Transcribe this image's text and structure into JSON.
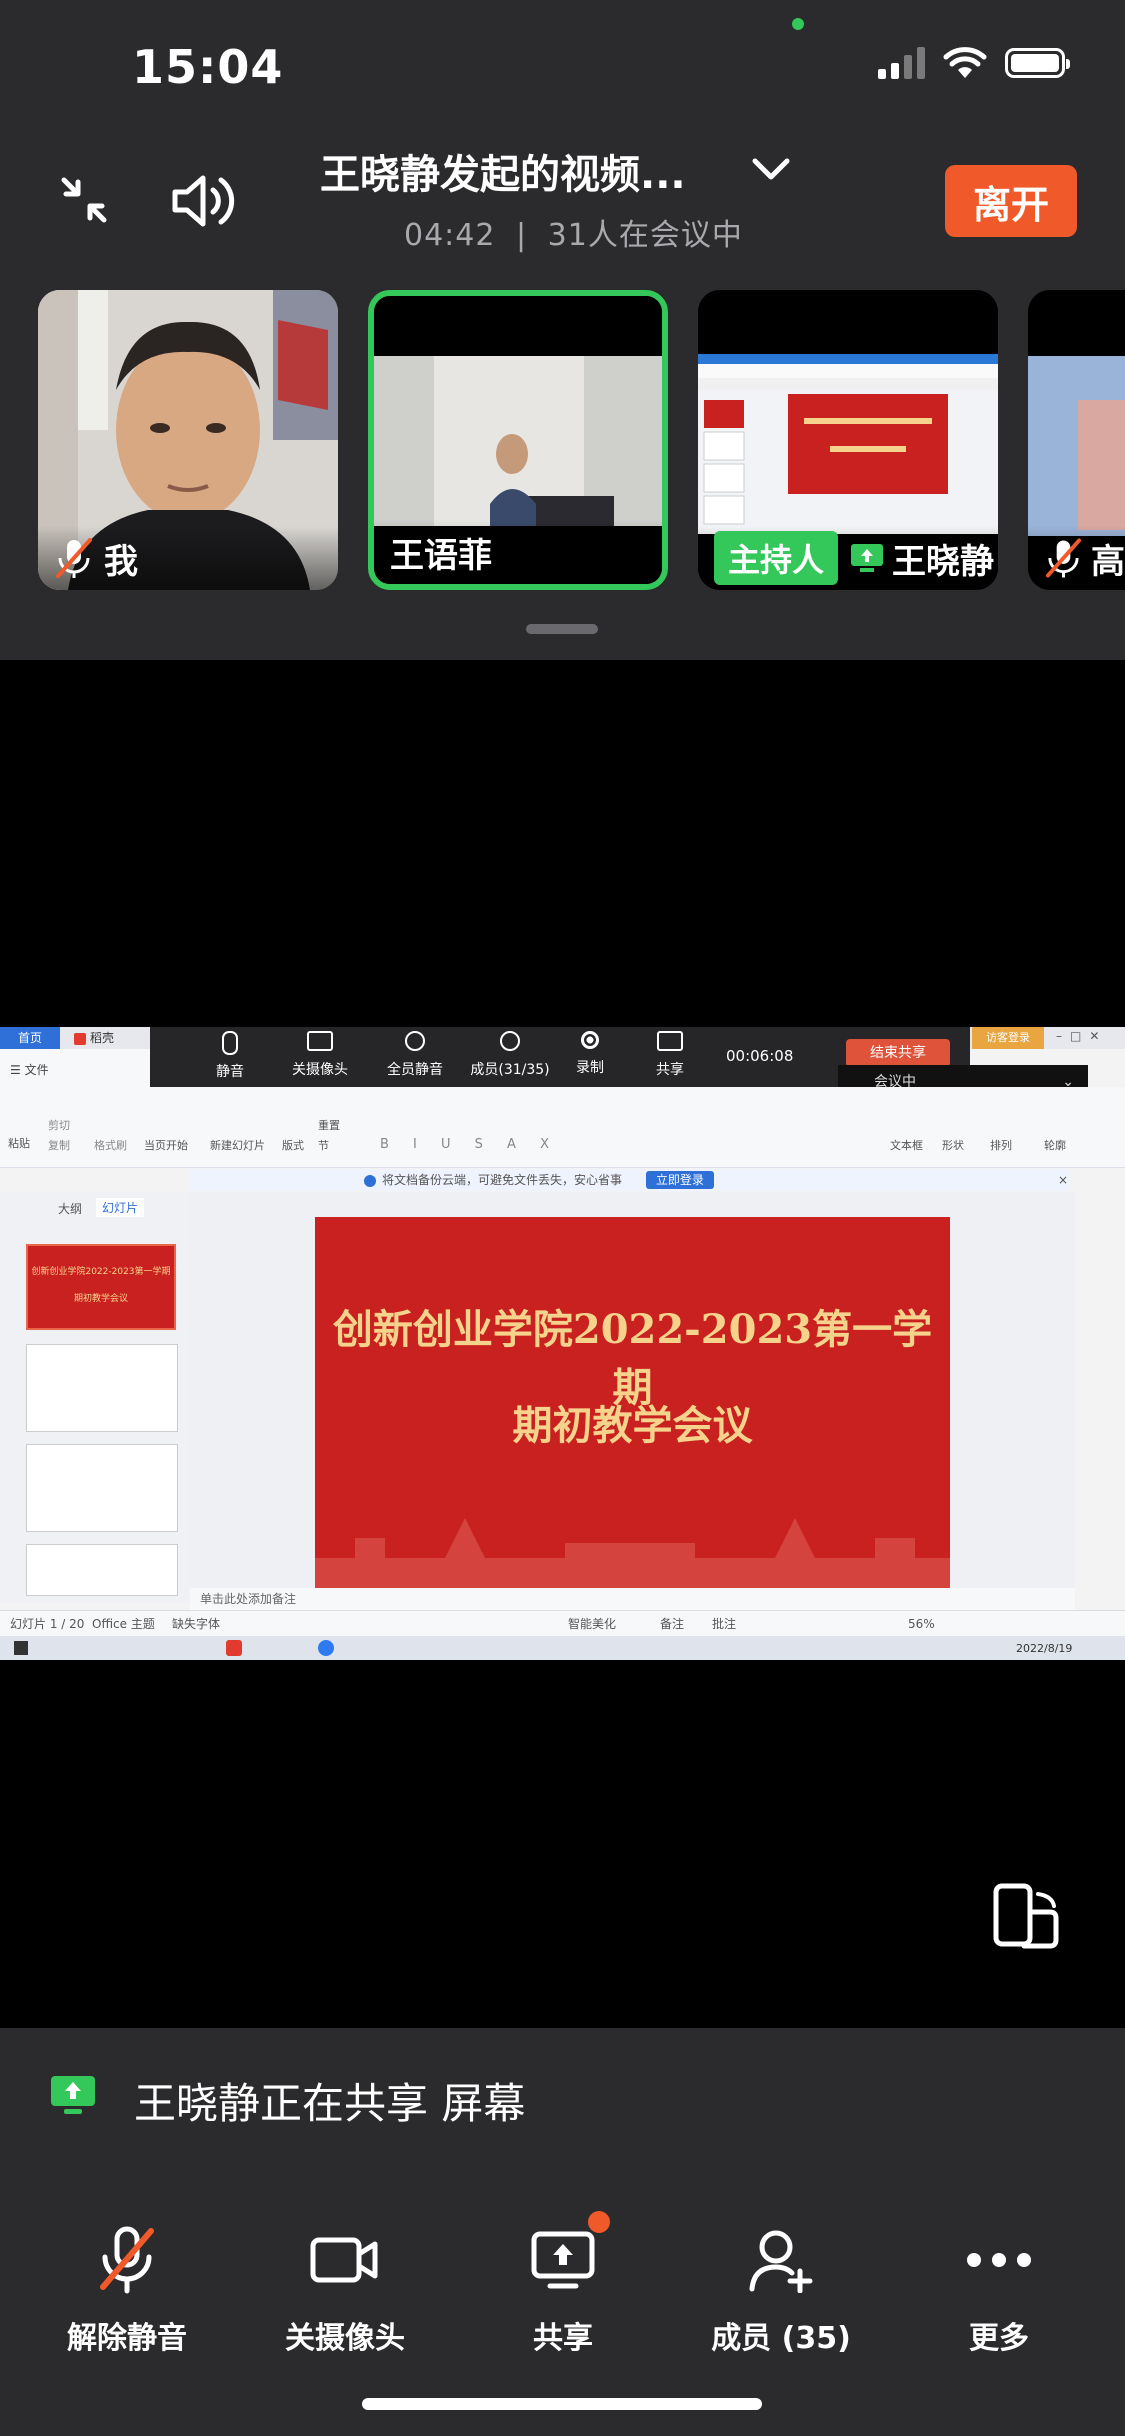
{
  "status_bar": {
    "time": "15:04"
  },
  "header": {
    "title": "王晓静发起的视频...",
    "duration": "04:42",
    "separator": "|",
    "participants_in_meeting": "31人在会议中",
    "leave_label": "离开"
  },
  "participants": [
    {
      "name": "我",
      "muted": true
    },
    {
      "name": "王语菲",
      "active_speaker": true
    },
    {
      "name": "王晓静",
      "role_badge": "主持人",
      "sharing": true
    },
    {
      "name": "高",
      "muted": true
    }
  ],
  "shared_screen": {
    "meeting_toolbar": {
      "mute": "静音",
      "camera": "关摄像头",
      "mute_all": "全员静音",
      "members": "成员(31/35)",
      "record": "录制",
      "share": "共享",
      "timer": "00:06:08",
      "end_share": "结束共享",
      "status_pill": "会议中",
      "login": "访客登录"
    },
    "app_tabs": [
      "首页",
      "稻壳"
    ],
    "ribbon_menu": "文件",
    "ribbon_labels": [
      "粘贴",
      "剪切",
      "复制",
      "格式刷",
      "当页开始",
      "新建幻灯片",
      "版式",
      "节",
      "重置",
      "文本框",
      "形状",
      "排列",
      "轮廓"
    ],
    "cloud_notice": "将文档备份云端，可避免文件丢失，安心省事",
    "cloud_button": "立即登录",
    "panel_tabs": [
      "大纲",
      "幻灯片"
    ],
    "slide_title_line1": "创新创业学院2022-2023第一学期",
    "slide_title_line2": "期初教学会议",
    "thumb1_line1": "创新创业学院2022-2023第一学期",
    "thumb1_line2": "期初教学会议",
    "notes_placeholder": "单击此处添加备注",
    "status": {
      "slide_counter": "幻灯片 1 / 20",
      "theme": "Office 主题",
      "missing_font": "缺失字体",
      "beautify": "智能美化",
      "notes": "备注",
      "comments": "批注",
      "zoom": "56%"
    },
    "taskbar_date": "2022/8/19"
  },
  "footer": {
    "sharing_message": "王晓静正在共享 屏幕",
    "toolbar": {
      "unmute": "解除静音",
      "camera_off": "关摄像头",
      "share": "共享",
      "members": "成员 (35)",
      "more": "更多"
    }
  }
}
